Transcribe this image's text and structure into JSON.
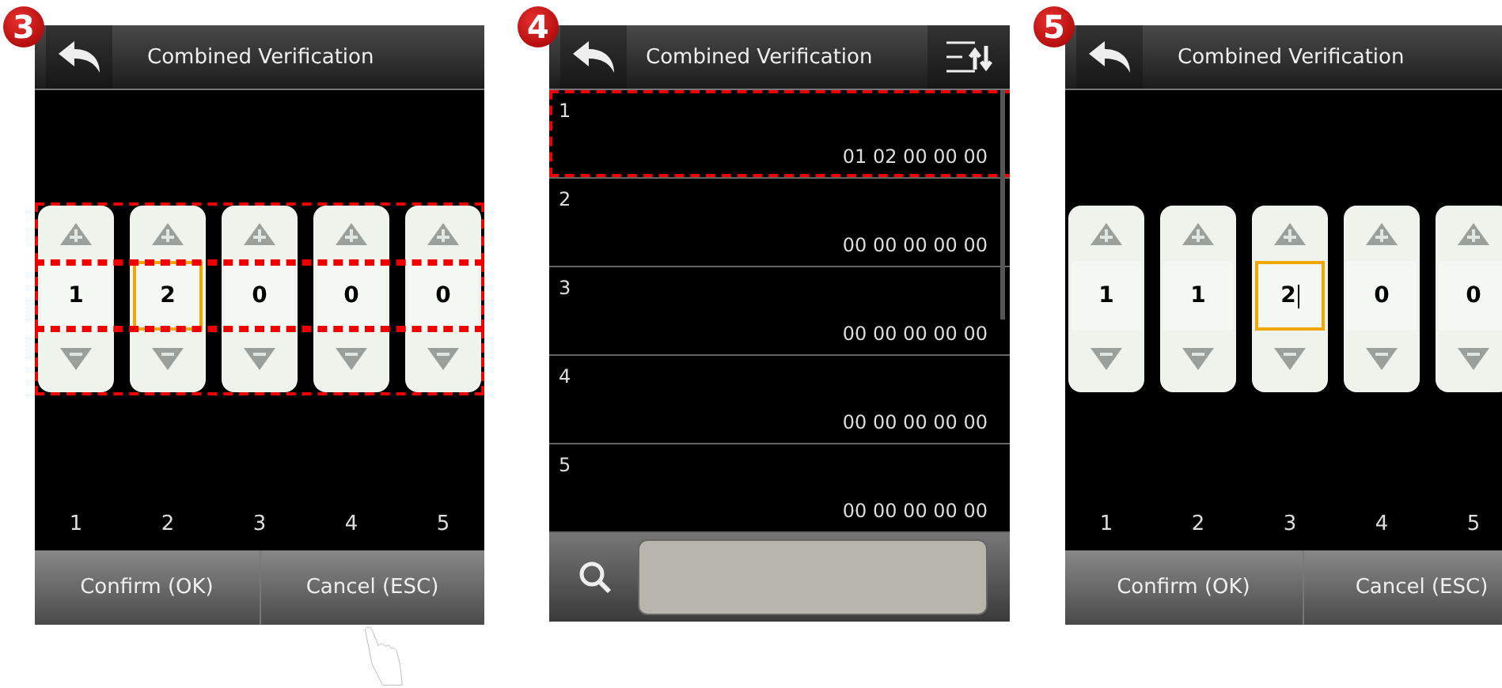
{
  "screens": [
    {
      "kind": "spinner",
      "step": "3",
      "title": "Combined Verification",
      "highlighted": true,
      "digits": [
        {
          "value": "1",
          "selected": false,
          "cursor": false
        },
        {
          "value": "2",
          "selected": true,
          "cursor": false
        },
        {
          "value": "0",
          "selected": false,
          "cursor": false
        },
        {
          "value": "0",
          "selected": false,
          "cursor": false
        },
        {
          "value": "0",
          "selected": false,
          "cursor": false
        }
      ],
      "labels": [
        "1",
        "2",
        "3",
        "4",
        "5"
      ],
      "buttons": [
        {
          "label": "Confirm (OK)"
        },
        {
          "label": "Cancel (ESC)"
        }
      ],
      "pointer": true
    },
    {
      "kind": "list",
      "step": "4",
      "title": "Combined Verification",
      "rows": [
        {
          "index": "1",
          "value": "01 02 00 00 00",
          "highlighted": true
        },
        {
          "index": "2",
          "value": "00 00 00 00 00",
          "highlighted": false
        },
        {
          "index": "3",
          "value": "00 00 00 00 00",
          "highlighted": false
        },
        {
          "index": "4",
          "value": "00 00 00 00 00",
          "highlighted": false
        },
        {
          "index": "5",
          "value": "00 00 00 00 00",
          "highlighted": false
        }
      ]
    },
    {
      "kind": "spinner",
      "step": "5",
      "title": "Combined Verification",
      "digits": [
        {
          "value": "1",
          "selected": false,
          "cursor": false
        },
        {
          "value": "1",
          "selected": false,
          "cursor": false
        },
        {
          "value": "2",
          "selected": true,
          "cursor": true
        },
        {
          "value": "0",
          "selected": false,
          "cursor": false
        },
        {
          "value": "0",
          "selected": false,
          "cursor": false
        }
      ],
      "labels": [
        "1",
        "2",
        "3",
        "4",
        "5"
      ],
      "buttons": [
        {
          "label": "Confirm (OK)"
        },
        {
          "label": "Cancel (ESC)"
        }
      ]
    }
  ]
}
